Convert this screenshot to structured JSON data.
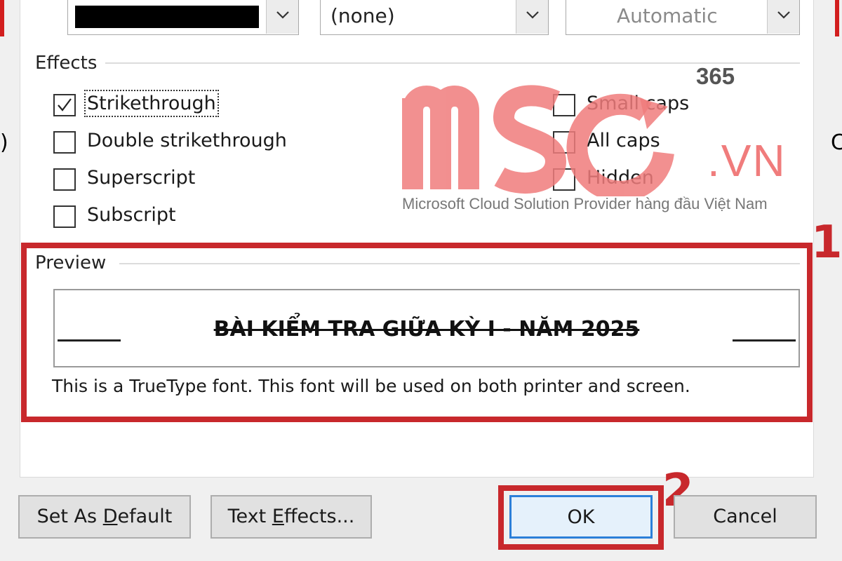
{
  "font_color": {
    "swatch_color": "#000000"
  },
  "underline_style": {
    "value": "(none)"
  },
  "underline_color": {
    "value": "Automatic"
  },
  "effects": {
    "label": "Effects",
    "left_column": [
      {
        "label": "Strikethrough",
        "checked": true
      },
      {
        "label": "Double strikethrough",
        "checked": false
      },
      {
        "label": "Superscript",
        "checked": false
      },
      {
        "label": "Subscript",
        "checked": false
      }
    ],
    "right_column": [
      {
        "label": "Small caps",
        "checked": false
      },
      {
        "label": "All caps",
        "checked": false
      },
      {
        "label": "Hidden",
        "checked": false
      }
    ]
  },
  "watermark": {
    "edition": "365",
    "domain_suffix": ".VN",
    "tagline": "Microsoft Cloud Solution Provider hàng đầu Việt Nam",
    "brand_color": "#f07c7c"
  },
  "preview": {
    "label": "Preview",
    "sample_text": "BÀI KIỂM TRA GIỮA KỲ I - NĂM 2025",
    "note": "This is a TrueType font. This font will be used on both printer and screen."
  },
  "annotations": {
    "step1": "1",
    "step2": "2",
    "highlight_color": "#c8282c"
  },
  "buttons": {
    "set_default": {
      "before": "Set As ",
      "mnemonic": "D",
      "after": "efault"
    },
    "text_effects": {
      "before": "Text ",
      "mnemonic": "E",
      "after": "ffects..."
    },
    "ok": "OK",
    "cancel": "Cancel"
  },
  "edge_marks": {
    "left": ")",
    "right": "C"
  }
}
